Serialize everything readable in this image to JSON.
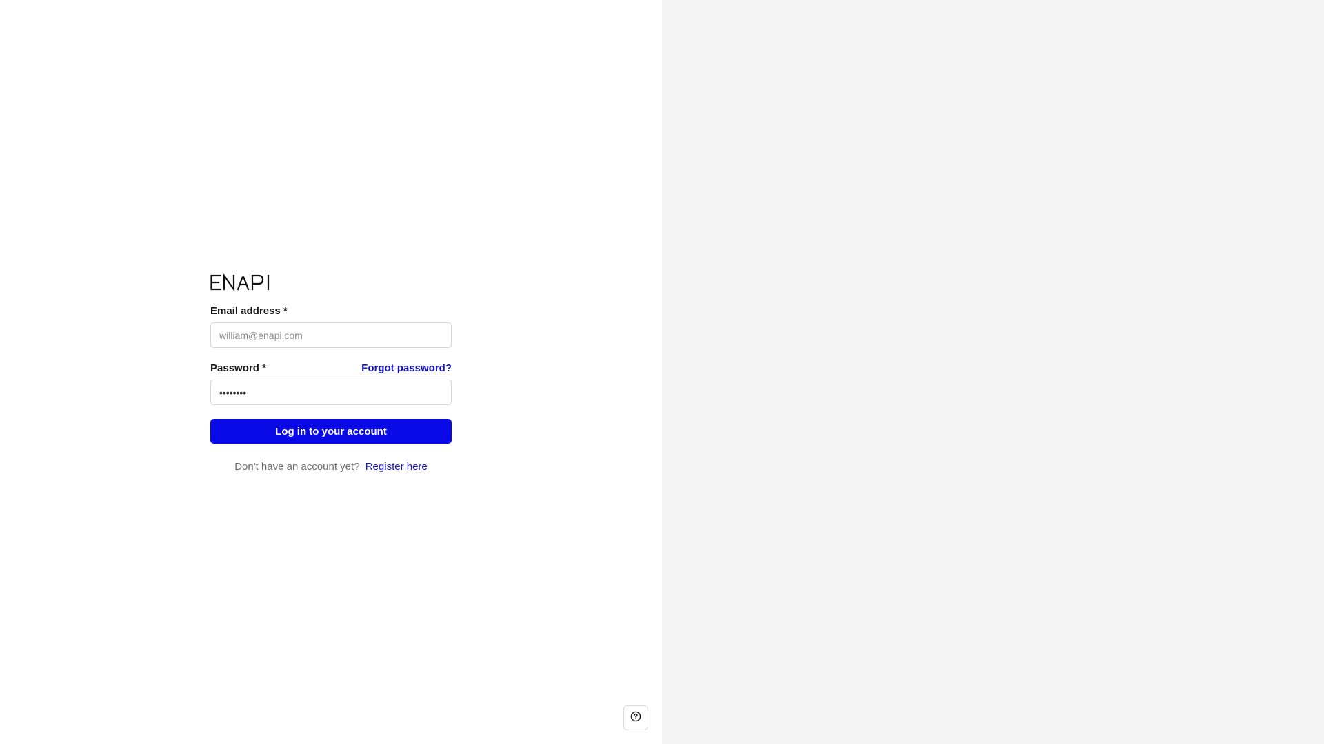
{
  "brand": {
    "logo_text": "ENAPI"
  },
  "login_form": {
    "email": {
      "label": "Email address *",
      "placeholder": "william@enapi.com",
      "value": ""
    },
    "password": {
      "label": "Password *",
      "value": "password",
      "forgot_link": "Forgot password?"
    },
    "submit_label": "Log in to your account",
    "register_prompt": "Don't have an account yet?",
    "register_link": "Register here"
  },
  "help": {
    "icon": "question-circle-icon"
  },
  "colors": {
    "accent": "#0a0ae6",
    "link": "#1414c9",
    "right_panel_bg": "#f3f3f3"
  }
}
